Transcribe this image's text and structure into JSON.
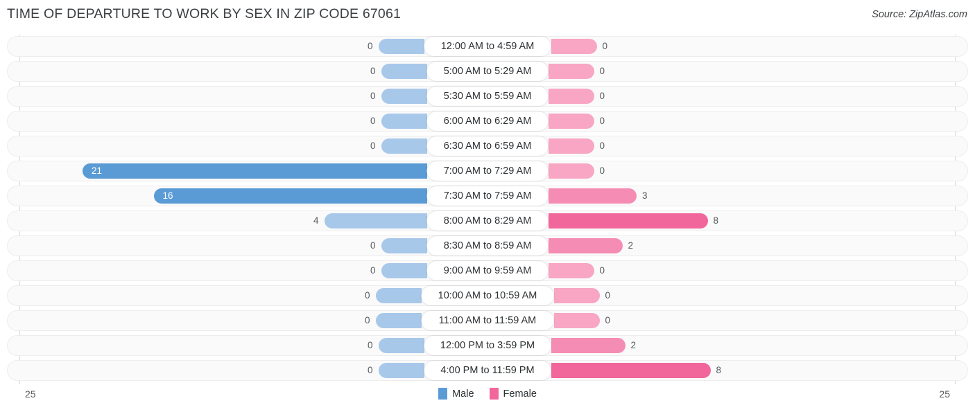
{
  "header": {
    "title": "TIME OF DEPARTURE TO WORK BY SEX IN ZIP CODE 67061",
    "source": "Source: ZipAtlas.com"
  },
  "footer": {
    "axis_left": "25",
    "axis_right": "25",
    "legend": [
      {
        "label": "Male",
        "color": "#5b9bd5"
      },
      {
        "label": "Female",
        "color": "#f2679b"
      }
    ]
  },
  "chart_data": {
    "type": "bar",
    "orientation": "horizontal-diverging",
    "title": "TIME OF DEPARTURE TO WORK BY SEX IN ZIP CODE 67061",
    "xlabel": "",
    "ylabel": "",
    "xlim": [
      25,
      25
    ],
    "axis_ticks": [
      "25",
      "25"
    ],
    "grid": false,
    "legend_position": "bottom-center",
    "categories": [
      "12:00 AM to 4:59 AM",
      "5:00 AM to 5:29 AM",
      "5:30 AM to 5:59 AM",
      "6:00 AM to 6:29 AM",
      "6:30 AM to 6:59 AM",
      "7:00 AM to 7:29 AM",
      "7:30 AM to 7:59 AM",
      "8:00 AM to 8:29 AM",
      "8:30 AM to 8:59 AM",
      "9:00 AM to 9:59 AM",
      "10:00 AM to 10:59 AM",
      "11:00 AM to 11:59 AM",
      "12:00 PM to 3:59 PM",
      "4:00 PM to 11:59 PM"
    ],
    "series": [
      {
        "name": "Male",
        "color": "#5b9bd5",
        "values": [
          0,
          0,
          0,
          0,
          0,
          21,
          16,
          4,
          0,
          0,
          0,
          0,
          0,
          0
        ]
      },
      {
        "name": "Female",
        "color": "#f2679b",
        "values": [
          0,
          0,
          0,
          0,
          0,
          0,
          3,
          8,
          2,
          0,
          0,
          0,
          2,
          8
        ]
      }
    ]
  }
}
